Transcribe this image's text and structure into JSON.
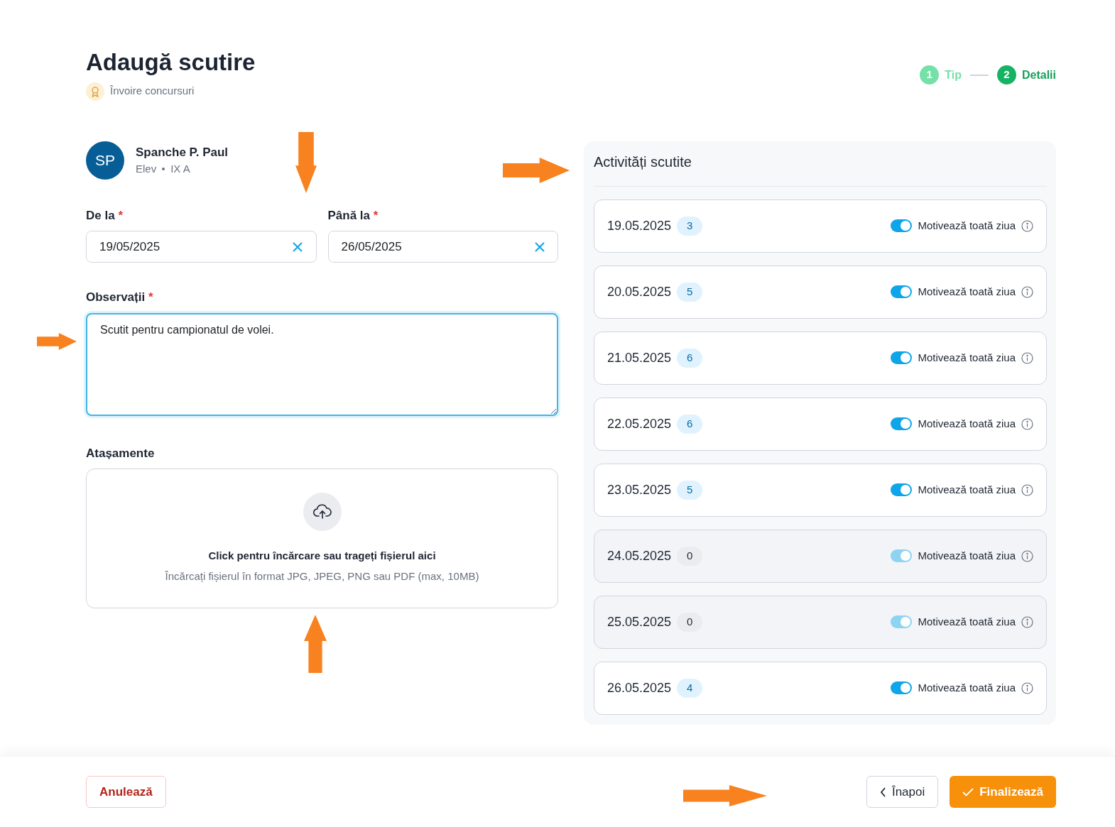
{
  "title": "Adaugă scutire",
  "subtitle": "Învoire concursuri",
  "steps": [
    {
      "number": "1",
      "label": "Tip",
      "selected": false
    },
    {
      "number": "2",
      "label": "Detalii",
      "selected": true
    }
  ],
  "student": {
    "initials": "SP",
    "name": "Spanche P. Paul",
    "role": "Elev",
    "class": "IX A"
  },
  "from": {
    "label": "De la",
    "required_mark": "*",
    "value": "19/05/2025"
  },
  "to": {
    "label": "Până la",
    "required_mark": "*",
    "value": "26/05/2025"
  },
  "notes": {
    "label": "Observații",
    "required_mark": "*",
    "value": "Scutit pentru campionatul de volei."
  },
  "attachments": {
    "label": "Atașamente",
    "prompt": "Click pentru încărcare sau trageți fișierul aici",
    "hint": "Încărcați fișierul în format JPG, JPEG, PNG sau PDF (max, 10MB)"
  },
  "panel": {
    "title": "Activități scutite",
    "days": [
      {
        "date": "19.05.2025",
        "count": "3",
        "toggle_label": "Motivează toată ziua",
        "on": true,
        "disabled": false
      },
      {
        "date": "20.05.2025",
        "count": "5",
        "toggle_label": "Motivează toată ziua",
        "on": true,
        "disabled": false
      },
      {
        "date": "21.05.2025",
        "count": "6",
        "toggle_label": "Motivează toată ziua",
        "on": true,
        "disabled": false
      },
      {
        "date": "22.05.2025",
        "count": "6",
        "toggle_label": "Motivează toată ziua",
        "on": true,
        "disabled": false
      },
      {
        "date": "23.05.2025",
        "count": "5",
        "toggle_label": "Motivează toată ziua",
        "on": true,
        "disabled": false
      },
      {
        "date": "24.05.2025",
        "count": "0",
        "toggle_label": "Motivează toată ziua",
        "on": true,
        "disabled": true
      },
      {
        "date": "25.05.2025",
        "count": "0",
        "toggle_label": "Motivează toată ziua",
        "on": true,
        "disabled": true
      },
      {
        "date": "26.05.2025",
        "count": "4",
        "toggle_label": "Motivează toată ziua",
        "on": true,
        "disabled": false
      }
    ]
  },
  "footer": {
    "cancel": "Anulează",
    "back": "Înapoi",
    "finish": "Finalizează"
  }
}
